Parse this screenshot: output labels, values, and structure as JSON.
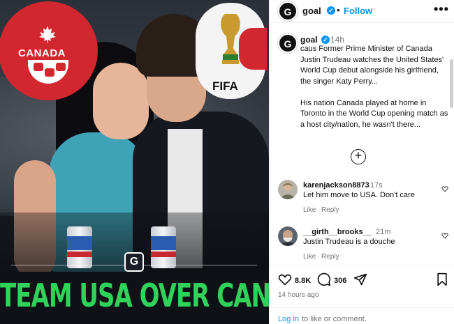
{
  "media": {
    "canada_badge_text": "CANADA",
    "fifa_text": "FIFA",
    "watermark_letter": "G",
    "banner_text": "TEAM USA OVER CANADA",
    "colors": {
      "banner_text": "#2fd35a",
      "canada_red": "#d3272f"
    }
  },
  "header": {
    "avatar_letter": "G",
    "username": "goal",
    "separator": "•",
    "follow_label": "Follow",
    "more_label": "•••"
  },
  "caption": {
    "avatar_letter": "G",
    "username": "goal",
    "time": "14h",
    "body": "caus Former Prime Minister of Canada Justin Trudeau watches the United States' World Cup debut alongside his girlfriend, the singer Katy Perry...\n\nHis nation Canada played at home in Toronto in the World Cup opening match as a host city/nation, he wasn't there..."
  },
  "load_more_label": "+",
  "comments": [
    {
      "username": "karenjackson8873",
      "time": "17s",
      "text": "Let him move to USA. Don't care",
      "like_label": "Like",
      "reply_label": "Reply"
    },
    {
      "username": "__girth__brooks__",
      "time": "21m",
      "text": "Justin Trudeau is a douche",
      "like_label": "Like",
      "reply_label": "Reply"
    }
  ],
  "actions": {
    "like_count": "8.8K",
    "comment_count": "306"
  },
  "time_ago": "14 hours ago",
  "login": {
    "link_label": "Log in",
    "rest_text": "to like or comment."
  },
  "icons": [
    "verified-icon",
    "heart-icon",
    "comment-icon",
    "share-icon",
    "bookmark-icon",
    "plus-circle-icon",
    "more-icon"
  ]
}
